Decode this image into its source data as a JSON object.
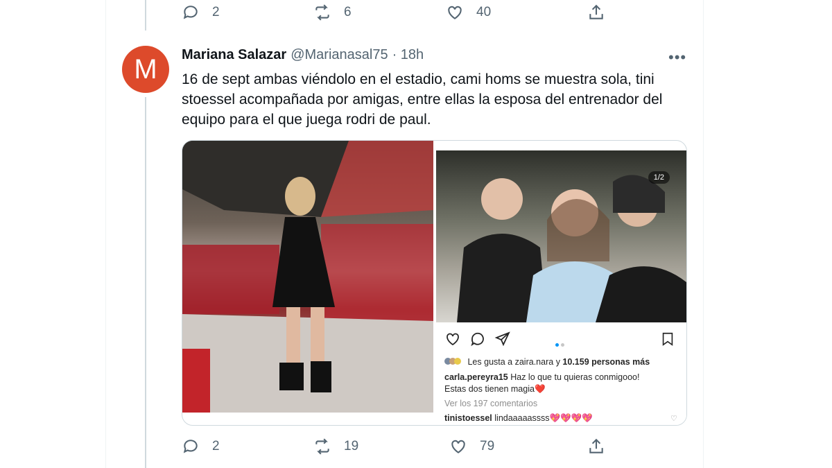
{
  "prev_tweet": {
    "actions": {
      "replies": "2",
      "retweets": "6",
      "likes": "40"
    }
  },
  "tweet": {
    "avatar_letter": "M",
    "author_name": "Mariana Salazar",
    "handle": "@Marianasal75",
    "time": "· 18h",
    "text": "16 de sept ambas viéndolo en el estadio, cami homs se muestra sola, tini stoessel acompañada por amigas, entre ellas la esposa del entrenador del equipo para el que juega rodri de paul.",
    "more_icon": "more-icon",
    "actions": {
      "replies": "2",
      "retweets": "19",
      "likes": "79"
    }
  },
  "instagram": {
    "image_counter": "1/2",
    "likes_line_prefix": "Les gusta a",
    "likes_user": "zaira.nara",
    "likes_connector": "y",
    "likes_count": "10.159 personas más",
    "comment_user": "carla.pereyra15",
    "comment_text": "Haz lo que tu quieras conmigooo!",
    "comment_text2": "Estas dos tienen magia❤️",
    "view_comments": "Ver los 197 comentarios",
    "reply_user": "tinistoessel",
    "reply_text": "lindaaaaassss💖💖💖💖"
  },
  "colors": {
    "avatar_bg": "#dd4a2b",
    "secondary_text": "#536471",
    "ig_link": "#0095f6"
  }
}
